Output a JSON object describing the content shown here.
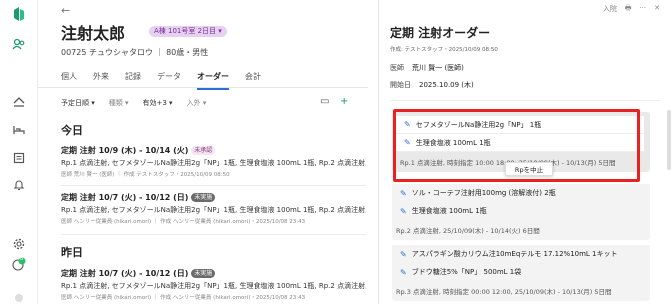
{
  "rail": {
    "items": [
      "logo-icon",
      "patients-icon",
      "home-icon",
      "bed-icon",
      "list-icon",
      "bell-icon",
      "settings-icon",
      "badge-icon"
    ],
    "notification_count": "8"
  },
  "patient": {
    "back": "←",
    "name": "注射太郎",
    "badge": "A棟 101号室 2日目 ▾",
    "id_line": "00725 チュウシャタロウ ｜ 80歳・男性"
  },
  "tabs": [
    "個人",
    "外来",
    "記録",
    "データ",
    "オーダー",
    "会計"
  ],
  "active_tab": "オーダー",
  "filters": [
    "予定日順 ▾",
    "種類 ▾",
    "有効+3 ▾",
    "入外 ▾"
  ],
  "sections": {
    "today": "今日",
    "yesterday": "昨日"
  },
  "orders": [
    {
      "title": "定期 注射 10/9 (木) - 10/14 (火)",
      "badge": "未承認",
      "detail": "Rp.1 点滴注射, セフメタゾールNa静注用2g「NP」1瓶, 生理食塩液 100mL 1瓶, Rp.2 点滴注射, …",
      "meta": "医師 荒川 賢一 (医師) ｜ 作成 テストスタッフ・2025/10/09 08:50"
    },
    {
      "title": "定期 注射 10/7 (火) - 10/12 (日)",
      "badge": "未実施",
      "detail": "Rp.1 点滴注射, セフメタゾールNa静注用2g「NP」1瓶, 生理食塩液 100mL 1瓶, Rp.2 点滴注射, …",
      "meta": "医師 ヘンリー従業員 (hikari.omori) ｜ 作成 ヘンリー従業員 (hikari.omori)・2025/10/08 23:43"
    },
    {
      "title": "定期 注射 10/7 (火) - 10/12 (日)",
      "badge": "未実施",
      "detail": "Rp.1 点滴注射, セフメタゾールNa静注用2g「NP」1瓶, 生理食塩液 100mL 1瓶, Rp.2 点滴注射, …",
      "meta": "医師 ヘンリー従業員 (hikari.omori) ｜ 作成 ヘンリー従業員 (hikari.omori)・2025/10/08 23:43"
    }
  ],
  "panel": {
    "top_actions": [
      "入院",
      "🖶",
      "···",
      "✕"
    ],
    "title": "定期 注射オーダー",
    "author": "作成: テストスタッフ・2025/10/09 08:50",
    "doctor_label": "医師",
    "doctor": "荒川 賢一 (医師)",
    "start_label": "開始日",
    "start": "2025.10.09 (木)",
    "rp1_drugs": [
      "セフメタゾールNa静注用2g「NP」 1瓶",
      "生理食塩液 100mL 1瓶"
    ],
    "rp1_foot": "Rp.1 点滴注射, 時刻指定 10:00 18:00, 25/10/09(木) - 10/13(月) 5日間",
    "tooltip": "Rpを中止",
    "rp2_drugs": [
      "ソル・コーテフ注射用100mg (溶解液付) 2瓶",
      "生理食塩液 100mL 1瓶"
    ],
    "rp2_foot": "Rp.2 点滴注射, 25/10/09(木) - 10/14(火) 6日間",
    "rp3_drugs": [
      "アスパラギン酸カリウム注10mEqテルモ 17.12%10mL 1キット",
      "ブドウ糖注5%「NP」 500mL 1袋"
    ],
    "rp3_foot": "Rp.3 点滴注射, 時刻指定 00:00 12:00, 25/10/09(木) - 10/13(月) 5日間"
  },
  "colors": {
    "accent": "#2a6fd6",
    "highlight": "#e8231f",
    "brand": "#1a9b6b"
  }
}
